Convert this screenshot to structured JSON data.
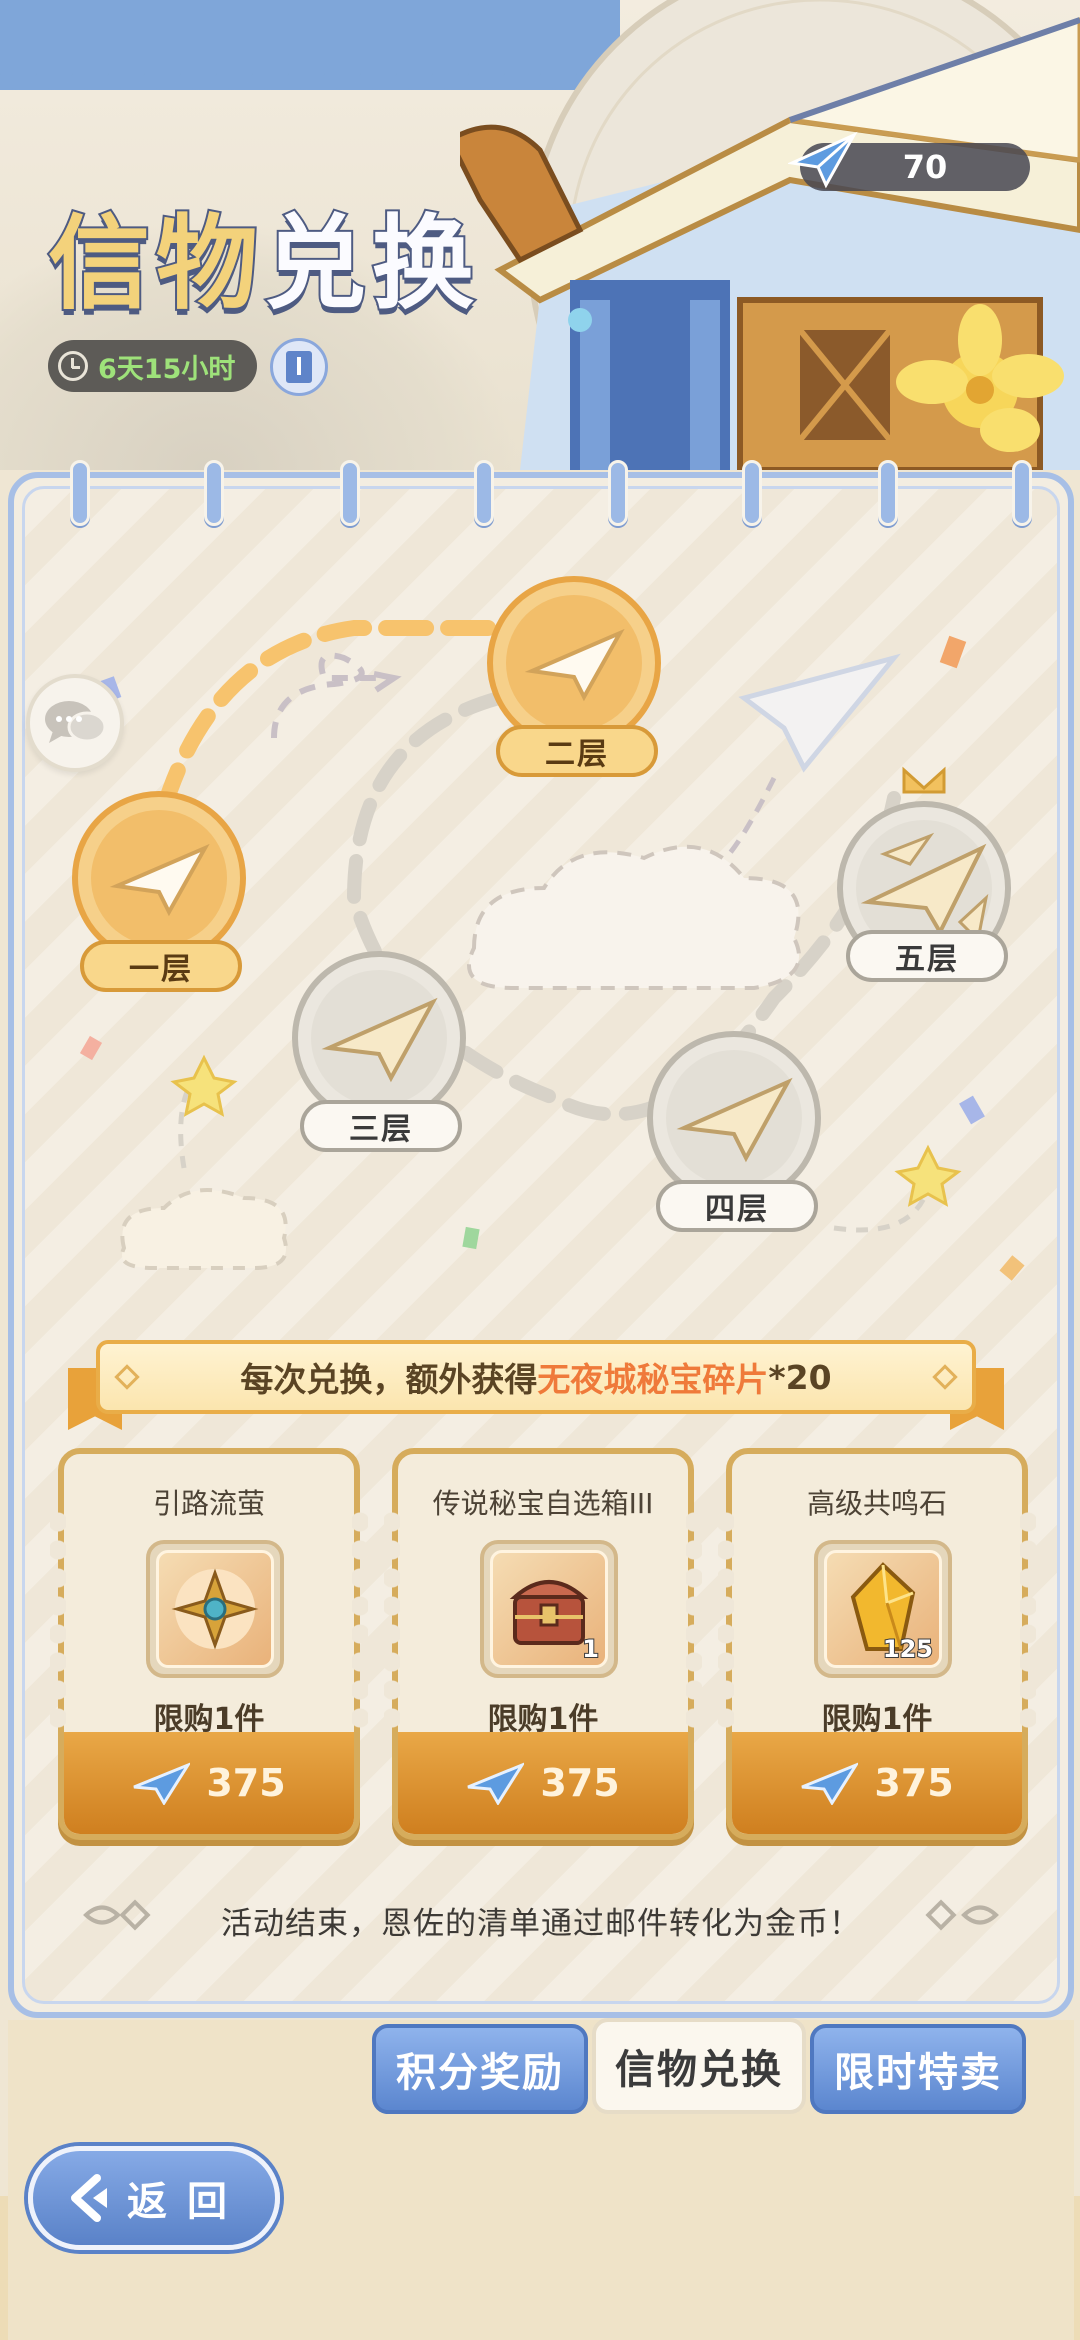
{
  "header": {
    "title_part1": "信物",
    "title_part2": "兑换",
    "timer": "6天15小时",
    "currency_value": "70"
  },
  "map": {
    "tiers": [
      {
        "label": "一层",
        "state": "unlocked"
      },
      {
        "label": "二层",
        "state": "unlocked"
      },
      {
        "label": "三层",
        "state": "locked"
      },
      {
        "label": "四层",
        "state": "locked"
      },
      {
        "label": "五层",
        "state": "locked"
      }
    ]
  },
  "banner": {
    "prefix": "每次兑换，额外获得",
    "highlight": "无夜城秘宝碎片",
    "suffix": "*20"
  },
  "items": [
    {
      "name": "引路流萤",
      "quantity": "",
      "limit": "限购1件",
      "price": "375"
    },
    {
      "name": "传说秘宝自选箱III",
      "quantity": "1",
      "limit": "限购1件",
      "price": "375"
    },
    {
      "name": "高级共鸣石",
      "quantity": "125",
      "limit": "限购1件",
      "price": "375"
    }
  ],
  "footnote": "活动结束，恩佐的清单通过邮件转化为金币！",
  "tabs": [
    {
      "label": "积分奖励",
      "active": false
    },
    {
      "label": "信物兑换",
      "active": true
    },
    {
      "label": "限时特卖",
      "active": false
    }
  ],
  "back_label": "返回",
  "colors": {
    "accent_blue": "#5b86cf",
    "accent_gold": "#e9a847",
    "highlight_orange": "#ef7a3a",
    "timer_green": "#9ee27a"
  }
}
